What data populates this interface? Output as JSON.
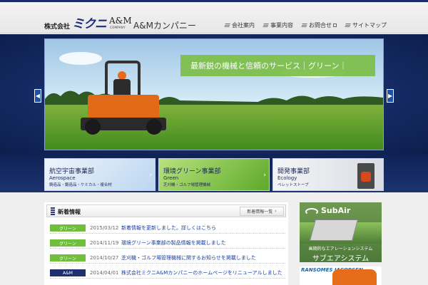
{
  "header": {
    "logo": {
      "kaisha": "株式会社",
      "mikuni": "ミクニ",
      "am": "A&M",
      "am_small": "COMPANY",
      "name": "A&Mカンパニー"
    },
    "nav": [
      {
        "label": "会社案内",
        "icon": "list-icon"
      },
      {
        "label": "事業内容",
        "icon": "list-icon"
      },
      {
        "label": "お問合せ",
        "icon": "list-icon",
        "external": true
      },
      {
        "label": "サイトマップ",
        "icon": "list-icon"
      }
    ]
  },
  "hero": {
    "banner": "最新鋭の機械と信頼のサービス｜グリーン｜",
    "prev_icon": "chevron-left-icon",
    "next_icon": "chevron-right-icon"
  },
  "departments": [
    {
      "title": "航空宇宙事業部",
      "en": "Aerospace",
      "sub": "鋳造品・鍛造品・ケミカル・複合材",
      "bg": "#cfe2f6"
    },
    {
      "title": "環境グリーン事業部",
      "en": "Green",
      "sub": "芝刈機・ゴルフ場管理機械",
      "bg": "#8fcf46"
    },
    {
      "title": "開発事業部",
      "en": "Ecology",
      "sub": "ペレットストーブ",
      "bg": "#e7e9ee"
    }
  ],
  "news": {
    "title": "新着情報",
    "list_button": "新着情報一覧",
    "items": [
      {
        "tag": "グリーン",
        "tag_color": "#6fbf3a",
        "date": "2015/03/12",
        "title": "新着情報を更新しました。詳しくはこちら"
      },
      {
        "tag": "グリーン",
        "tag_color": "#6fbf3a",
        "date": "2014/11/19",
        "title": "環境グリーン事業部の製品情報を掲載しました"
      },
      {
        "tag": "グリーン",
        "tag_color": "#6fbf3a",
        "date": "2014/10/27",
        "title": "芝刈機・ゴルフ場管理機械に関するお知らせを掲載しました"
      },
      {
        "tag": "A&M",
        "tag_color": "#1d2f6f",
        "date": "2014/04/01",
        "title": "株式会社ミクニA&Mカンパニーのホームページをリニューアルしました"
      }
    ]
  },
  "sidebar": {
    "ad1": {
      "brand": "SubAir",
      "line1": "画期的なエアレーションシステム",
      "line2": "サブエアシステム"
    },
    "ad2": {
      "brand": "RANSOMES JACOBSEN"
    }
  },
  "colors": {
    "navy": "#1c2d6b",
    "green": "#6fbf3a",
    "link": "#1a3e9c"
  }
}
